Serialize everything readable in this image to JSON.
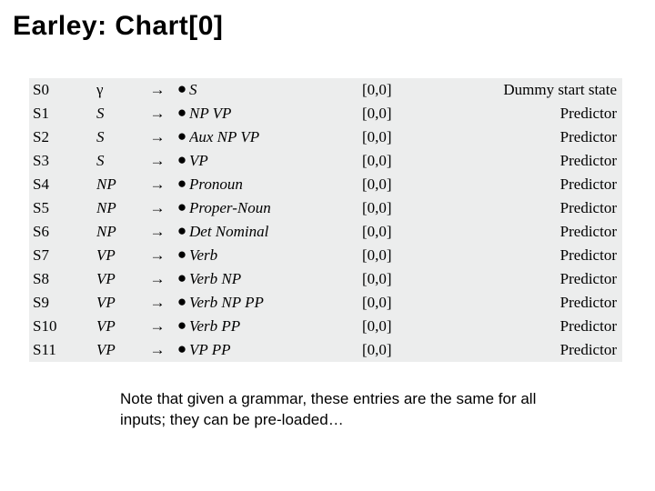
{
  "title": "Earley: Chart[0]",
  "arrow_glyph": "→",
  "dot_glyph": "●",
  "rows": [
    {
      "state": "S0",
      "lhs": "γ",
      "lhs_class": "gamma",
      "rhs": "S",
      "span": "[0,0]",
      "label": "Dummy start state"
    },
    {
      "state": "S1",
      "lhs": "S",
      "lhs_class": "",
      "rhs": "NP VP",
      "span": "[0,0]",
      "label": "Predictor"
    },
    {
      "state": "S2",
      "lhs": "S",
      "lhs_class": "",
      "rhs": "Aux NP VP",
      "span": "[0,0]",
      "label": "Predictor"
    },
    {
      "state": "S3",
      "lhs": "S",
      "lhs_class": "",
      "rhs": "VP",
      "span": "[0,0]",
      "label": "Predictor"
    },
    {
      "state": "S4",
      "lhs": "NP",
      "lhs_class": "",
      "rhs": "Pronoun",
      "span": "[0,0]",
      "label": "Predictor"
    },
    {
      "state": "S5",
      "lhs": "NP",
      "lhs_class": "",
      "rhs": "Proper-Noun",
      "span": "[0,0]",
      "label": "Predictor"
    },
    {
      "state": "S6",
      "lhs": "NP",
      "lhs_class": "",
      "rhs": "Det Nominal",
      "span": "[0,0]",
      "label": "Predictor"
    },
    {
      "state": "S7",
      "lhs": "VP",
      "lhs_class": "",
      "rhs": "Verb",
      "span": "[0,0]",
      "label": "Predictor"
    },
    {
      "state": "S8",
      "lhs": "VP",
      "lhs_class": "",
      "rhs": "Verb NP",
      "span": "[0,0]",
      "label": "Predictor"
    },
    {
      "state": "S9",
      "lhs": "VP",
      "lhs_class": "",
      "rhs": "Verb NP PP",
      "span": "[0,0]",
      "label": "Predictor"
    },
    {
      "state": "S10",
      "lhs": "VP",
      "lhs_class": "",
      "rhs": "Verb PP",
      "span": "[0,0]",
      "label": "Predictor"
    },
    {
      "state": "S11",
      "lhs": "VP",
      "lhs_class": "",
      "rhs": "VP PP",
      "span": "[0,0]",
      "label": "Predictor"
    }
  ],
  "note": "Note that given a grammar, these entries are the same for all inputs; they can be pre-loaded…"
}
